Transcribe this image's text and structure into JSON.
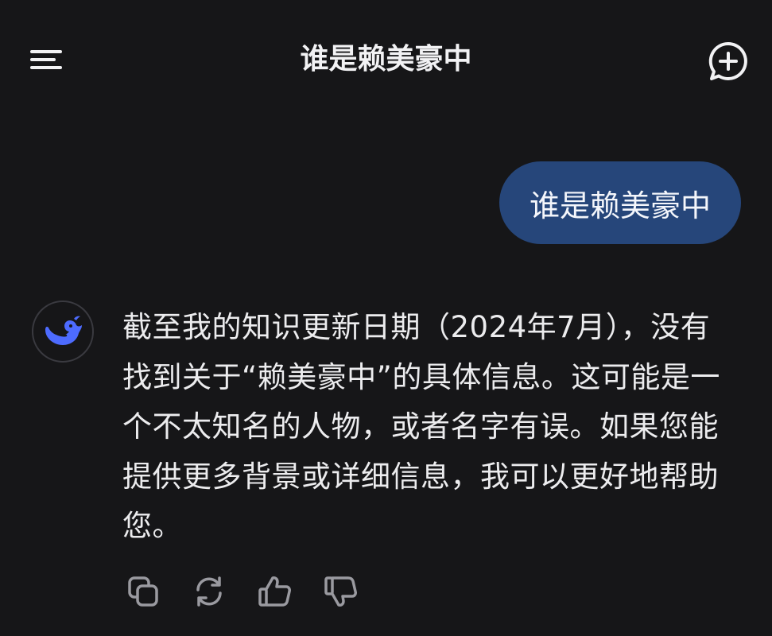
{
  "header": {
    "title": "谁是赖美豪中",
    "menu_icon": "menu-icon",
    "new_chat_icon": "new-chat-icon"
  },
  "conversation": {
    "user_message": "谁是赖美豪中",
    "assistant_message": "截至我的知识更新日期（2024年7月），没有找到关于“赖美豪中”的具体信息。这可能是一个不太知名的人物，或者名字有误。如果您能提供更多背景或详细信息，我可以更好地帮助您。",
    "assistant_avatar_icon": "whale-logo-icon"
  },
  "actions": {
    "copy_icon": "copy-icon",
    "regenerate_icon": "regenerate-icon",
    "like_icon": "thumbs-up-icon",
    "dislike_icon": "thumbs-down-icon"
  },
  "colors": {
    "background": "#161618",
    "user_bubble": "#26467a",
    "accent_logo": "#4d6bfe",
    "icon_gray": "#9a9aa0"
  }
}
